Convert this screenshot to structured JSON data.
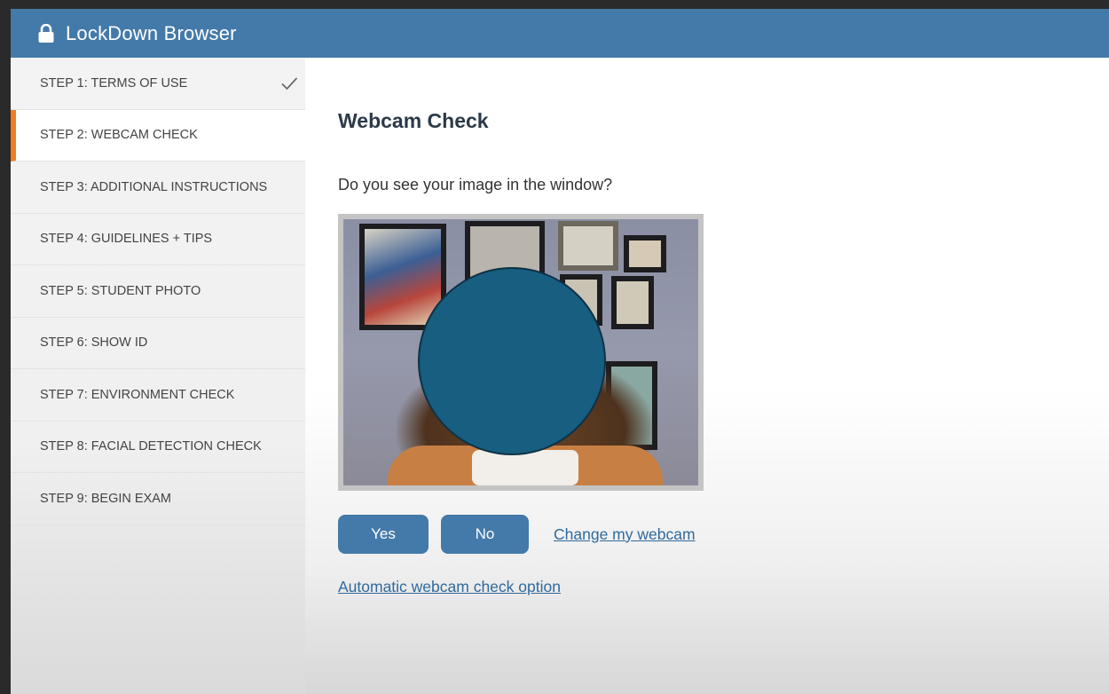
{
  "app": {
    "title": "LockDown Browser"
  },
  "sidebar": {
    "steps": [
      {
        "label": "STEP 1: TERMS OF USE",
        "completed": true
      },
      {
        "label": "STEP 2: WEBCAM CHECK",
        "active": true
      },
      {
        "label": "STEP 3: ADDITIONAL INSTRUCTIONS"
      },
      {
        "label": "STEP 4: GUIDELINES + TIPS"
      },
      {
        "label": "STEP 5: STUDENT PHOTO"
      },
      {
        "label": "STEP 6: SHOW ID"
      },
      {
        "label": "STEP 7: ENVIRONMENT CHECK"
      },
      {
        "label": "STEP 8: FACIAL DETECTION CHECK"
      },
      {
        "label": "STEP 9: BEGIN EXAM"
      }
    ]
  },
  "main": {
    "heading": "Webcam Check",
    "question": "Do you see your image in the window?",
    "yes_label": "Yes",
    "no_label": "No",
    "change_webcam_label": "Change my webcam",
    "auto_check_label": "Automatic webcam check option"
  },
  "colors": {
    "titlebar": "#437aa9",
    "active_accent": "#f27c22",
    "button": "#437aa9",
    "link": "#2f6a9e"
  },
  "icons": {
    "titlebar": "lock-icon",
    "step_completed": "checkmark-icon"
  }
}
